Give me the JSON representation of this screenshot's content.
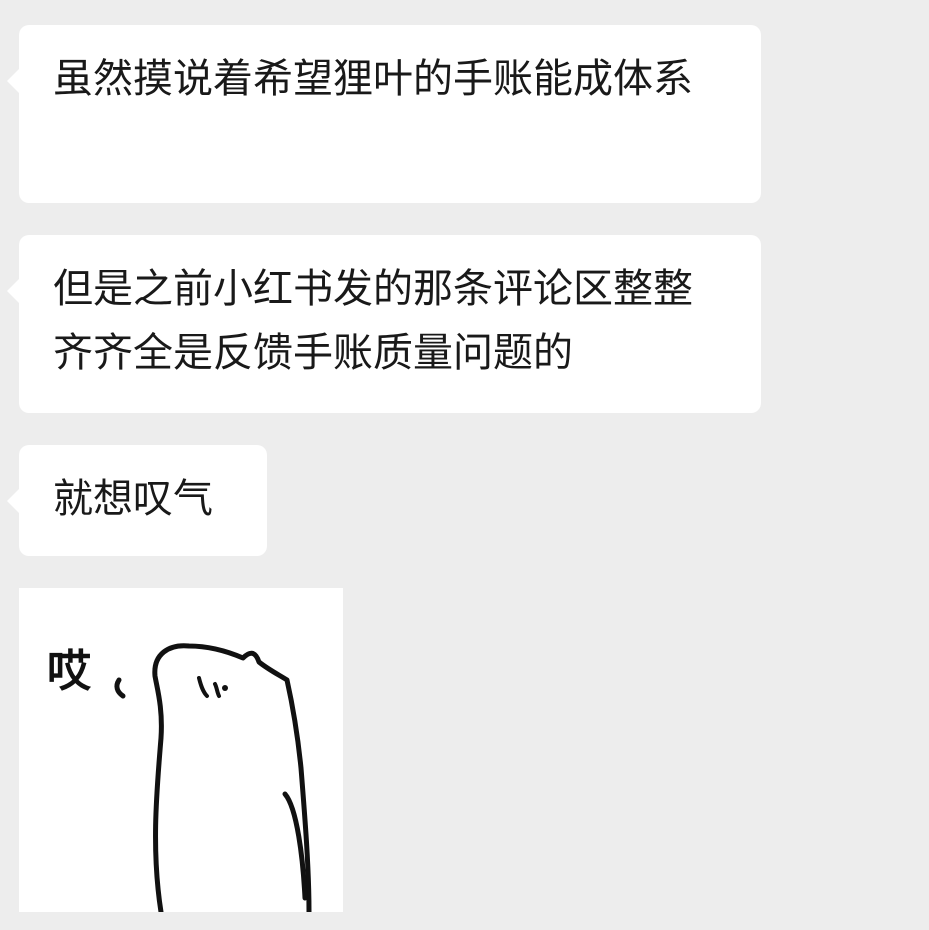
{
  "messages": [
    {
      "text": "虽然摸说着希望狸叶的手账能成体系"
    },
    {
      "text": "但是之前小红书发的那条评论区整整齐齐全是反馈手账质量问题的"
    },
    {
      "text": "就想叹气"
    }
  ],
  "sticker": {
    "caption": "哎",
    "icon": "sighing-cat-sticker"
  },
  "colors": {
    "background": "#ededed",
    "bubble": "#ffffff",
    "text": "#191919"
  }
}
